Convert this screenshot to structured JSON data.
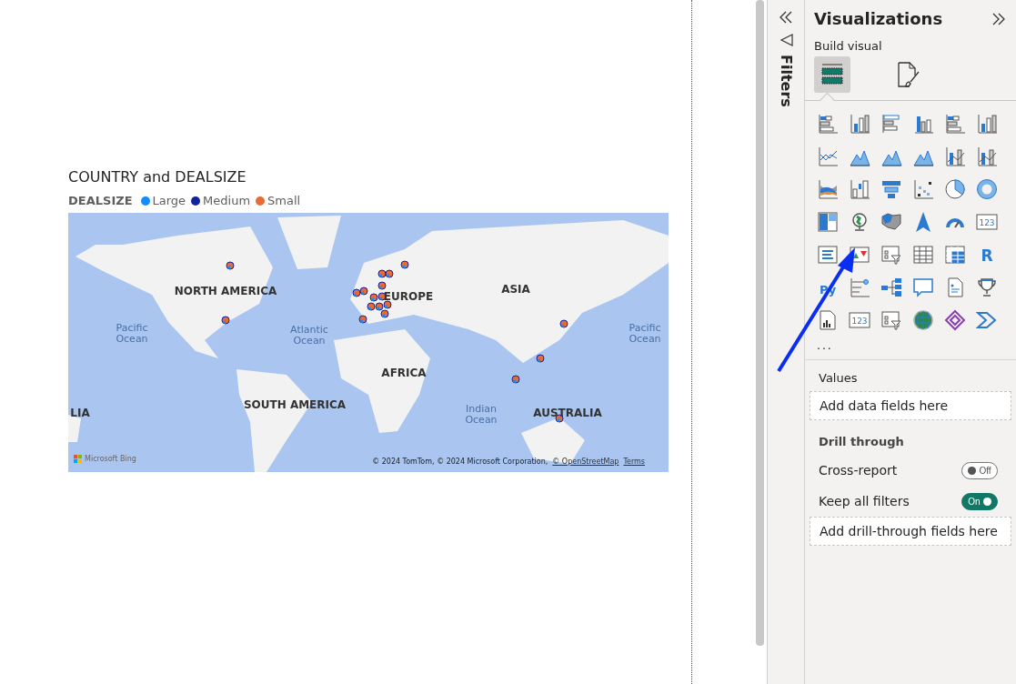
{
  "report": {
    "visual": {
      "title": "COUNTRY and DEALSIZE",
      "legend": {
        "title": "DEALSIZE",
        "items": [
          {
            "label": "Large",
            "color": "#118dff"
          },
          {
            "label": "Medium",
            "color": "#12239e"
          },
          {
            "label": "Small",
            "color": "#e66c37"
          }
        ]
      },
      "map": {
        "labels": [
          {
            "kind": "continent",
            "text": "NORTH AMERICA"
          },
          {
            "kind": "continent",
            "text": "EUROPE"
          },
          {
            "kind": "continent",
            "text": "ASIA"
          },
          {
            "kind": "ocean",
            "text": "Pacific Ocean"
          },
          {
            "kind": "ocean",
            "text": "Atlantic Ocean"
          },
          {
            "kind": "ocean",
            "text": "Pacific Ocean"
          },
          {
            "kind": "continent",
            "text": "AFRICA"
          },
          {
            "kind": "continent",
            "text": "LIA"
          },
          {
            "kind": "continent",
            "text": "SOUTH AMERICA"
          },
          {
            "kind": "ocean",
            "text": "Indian Ocean"
          },
          {
            "kind": "continent",
            "text": "AUSTRALIA"
          }
        ],
        "logo": "Microsoft Bing",
        "attribution": "© 2024 TomTom, © 2024 Microsoft Corporation,",
        "links": [
          "© OpenStreetMap",
          "Terms"
        ]
      }
    }
  },
  "filters_pane": {
    "title": "Filters"
  },
  "visualizations_pane": {
    "title": "Visualizations",
    "subtitle": "Build visual",
    "tabs": [
      {
        "kind": "fields",
        "selected": true
      },
      {
        "kind": "format",
        "selected": false
      }
    ],
    "visuals": [
      {
        "kind": "stacked-bar"
      },
      {
        "kind": "stacked-column"
      },
      {
        "kind": "clustered-bar"
      },
      {
        "kind": "clustered-column"
      },
      {
        "kind": "stacked-bar"
      },
      {
        "kind": "stacked-column"
      },
      {
        "kind": "line"
      },
      {
        "kind": "area"
      },
      {
        "kind": "area"
      },
      {
        "kind": "area"
      },
      {
        "kind": "line-column"
      },
      {
        "kind": "line-column"
      },
      {
        "kind": "ribbon"
      },
      {
        "kind": "waterfall"
      },
      {
        "kind": "funnel"
      },
      {
        "kind": "scatter"
      },
      {
        "kind": "pie"
      },
      {
        "kind": "donut"
      },
      {
        "kind": "treemap"
      },
      {
        "kind": "globe"
      },
      {
        "kind": "filled-map"
      },
      {
        "kind": "arrow"
      },
      {
        "kind": "gauge"
      },
      {
        "kind": "card",
        "glyph": "123"
      },
      {
        "kind": "list"
      },
      {
        "kind": "kpi"
      },
      {
        "kind": "slicer"
      },
      {
        "kind": "table"
      },
      {
        "kind": "matrix"
      },
      {
        "kind": "letter",
        "glyph": "R"
      },
      {
        "kind": "letter",
        "glyph": "Py"
      },
      {
        "kind": "decomposition"
      },
      {
        "kind": "tree"
      },
      {
        "kind": "speech"
      },
      {
        "kind": "document"
      },
      {
        "kind": "trophy"
      },
      {
        "kind": "report"
      },
      {
        "kind": "card",
        "glyph": "123"
      },
      {
        "kind": "slicer"
      },
      {
        "kind": "globe-map"
      },
      {
        "kind": "diamond"
      },
      {
        "kind": "chevron"
      }
    ],
    "more": "...",
    "values": {
      "title": "Values",
      "placeholder": "Add data fields here"
    },
    "drill_through": {
      "title": "Drill through",
      "toggles": [
        {
          "label": "Cross-report",
          "on": false,
          "state_text": "Off"
        },
        {
          "label": "Keep all filters",
          "on": true,
          "state_text": "On"
        }
      ],
      "placeholder": "Add drill-through fields here"
    }
  }
}
